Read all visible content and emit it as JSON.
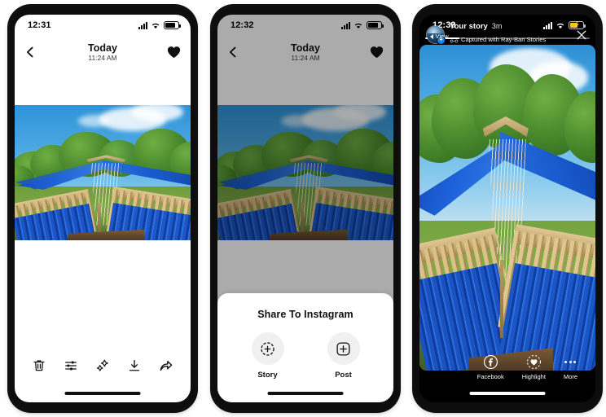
{
  "phones": [
    {
      "id": "photo-viewer",
      "status": {
        "time": "12:31",
        "battery_state": "normal"
      },
      "nav": {
        "title": "Today",
        "subtitle": "11:24 AM",
        "back_icon": "chevron-left-icon",
        "favorite_icon": "heart-filled-icon"
      },
      "toolbar": [
        {
          "name": "delete",
          "icon": "trash-icon"
        },
        {
          "name": "adjust",
          "icon": "sliders-icon"
        },
        {
          "name": "enhance",
          "icon": "magic-wand-icon"
        },
        {
          "name": "download",
          "icon": "download-icon"
        },
        {
          "name": "share",
          "icon": "share-arrow-icon"
        }
      ]
    },
    {
      "id": "share-sheet",
      "status": {
        "time": "12:32",
        "battery_state": "normal"
      },
      "nav": {
        "title": "Today",
        "subtitle": "11:24 AM",
        "back_icon": "chevron-left-icon",
        "favorite_icon": "heart-filled-icon"
      },
      "sheet": {
        "title": "Share To Instagram",
        "options": [
          {
            "label": "Story",
            "icon": "story-plus-icon"
          },
          {
            "label": "Post",
            "icon": "post-plus-icon"
          }
        ]
      }
    },
    {
      "id": "instagram-story",
      "status": {
        "time": "12:39",
        "battery_state": "low-power",
        "back_label": "View"
      },
      "story": {
        "username": "Your story",
        "timestamp": "3m",
        "attribution": "Captured with Ray-Ban Stories",
        "attribution_icon": "glasses-icon",
        "progress_percent": 21,
        "close_icon": "close-icon",
        "avatar_badge": "+"
      },
      "actions": [
        {
          "label": "Facebook",
          "icon": "facebook-icon"
        },
        {
          "label": "Highlight",
          "icon": "highlight-heart-icon"
        },
        {
          "label": "More",
          "icon": "more-dots-icon"
        }
      ]
    }
  ],
  "colors": {
    "accent_blue": "#0b84f3",
    "battery_low": "#f5c518",
    "sheet_bg": "#ffffff",
    "icon_bg": "#f0f0f0",
    "dim_overlay": "rgba(0,0,0,0.33)"
  }
}
